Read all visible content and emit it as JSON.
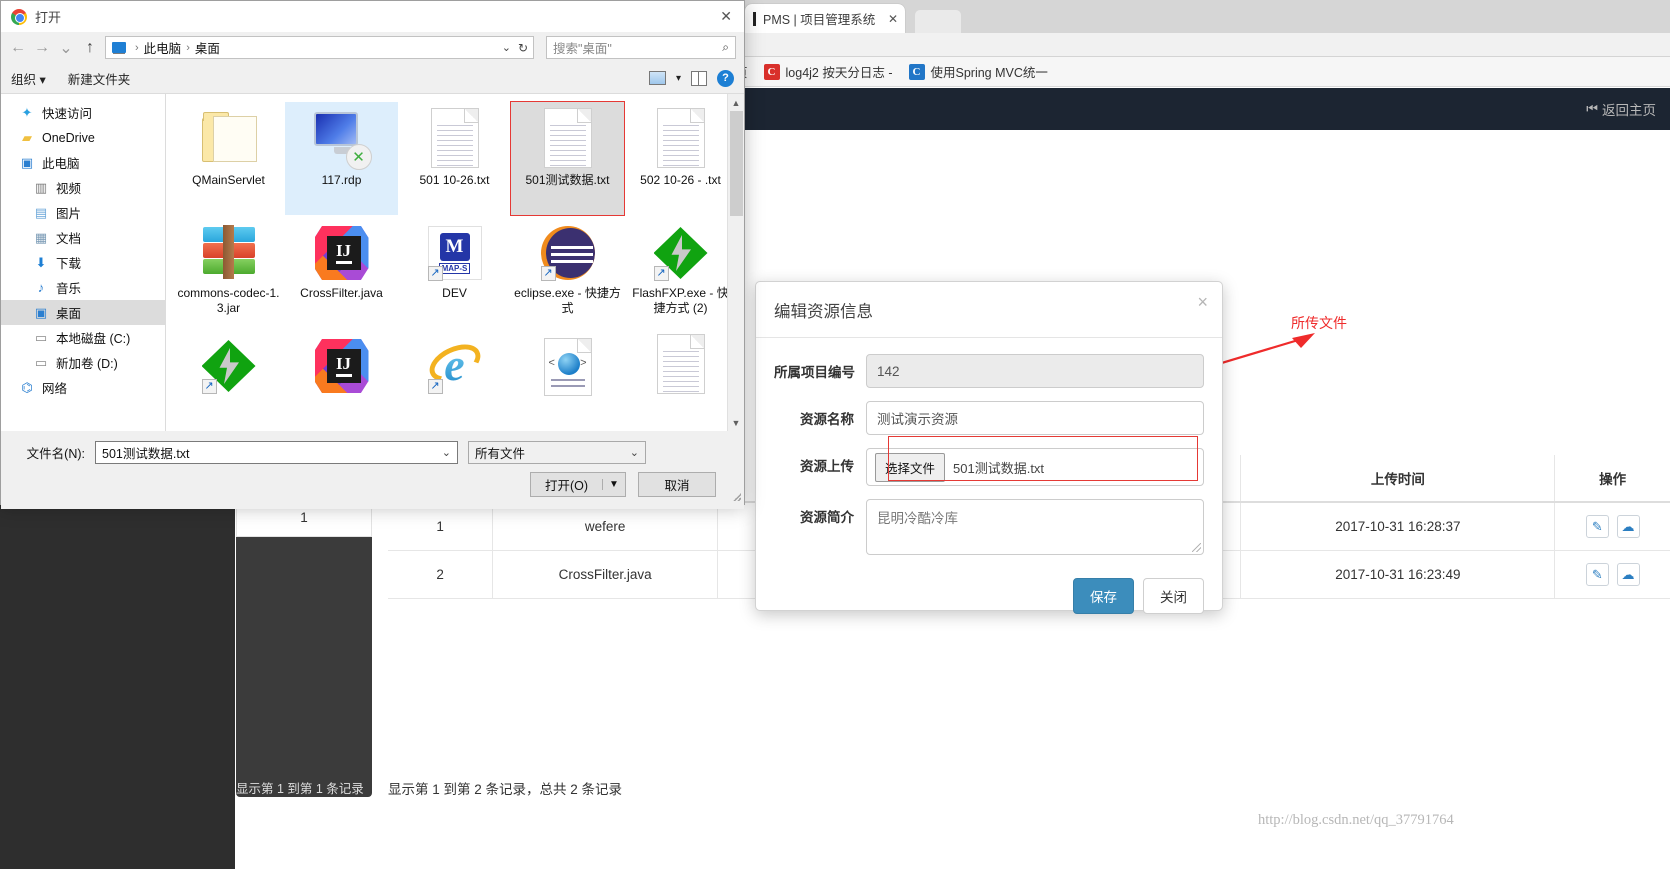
{
  "browser": {
    "tabs": [
      {
        "title": "PMS | 项目管理系统",
        "close": "✕"
      }
    ],
    "left_close": "✕",
    "bookmarks": [
      {
        "icon_letter": "页",
        "label": "页",
        "icon_kind": "plain"
      },
      {
        "icon_letter": "C",
        "label": "log4j2 按天分日志 -",
        "icon_kind": "red"
      },
      {
        "icon_letter": "C",
        "label": "使用Spring MVC统一",
        "icon_kind": "blue"
      }
    ]
  },
  "site": {
    "back_home": "返回主页",
    "back_home_icon": "⏮"
  },
  "table": {
    "headers": [
      "",
      "",
      "",
      "上传时间",
      "操作"
    ],
    "header_time": "上传时间",
    "header_op": "操作",
    "rows": [
      {
        "id": "1",
        "name": "wefere",
        "desc": "",
        "time": "2017-10-31 16:28:37",
        "edit_icon": "✎",
        "download_icon": "☁"
      },
      {
        "id": "2",
        "name": "CrossFilter.java",
        "desc": "",
        "time": "2017-10-31 16:23:49",
        "edit_icon": "✎",
        "download_icon": "☁"
      }
    ],
    "footer": "显示第 1 到第 2 条记录，总共 2 条记录"
  },
  "sidebar_table": {
    "value": "1",
    "footer": "显示第 1 到第 1 条记录"
  },
  "modal": {
    "title": "编辑资源信息",
    "close": "×",
    "fields": {
      "project_no_label": "所属项目编号",
      "project_no_value": "142",
      "res_name_label": "资源名称",
      "res_name_value": "测试演示资源",
      "upload_label": "资源上传",
      "upload_button": "选择文件",
      "upload_filename": "501测试数据.txt",
      "desc_label": "资源简介",
      "desc_value": "昆明冷酷冷库"
    },
    "save": "保存",
    "close_btn": "关闭"
  },
  "annotation": {
    "text": "所传文件"
  },
  "watermark": "http://blog.csdn.net/qq_37791764",
  "file_dialog": {
    "title": "打开",
    "close": "✕",
    "nav": {
      "back": "←",
      "forward": "→",
      "recent": "⌄",
      "up": "↑",
      "breadcrumb": [
        "此电脑",
        "桌面"
      ],
      "caret": "⌄",
      "refresh": "↻",
      "search_placeholder": "搜索\"桌面\""
    },
    "toolbar": {
      "organize": "组织 ▾",
      "new_folder": "新建文件夹",
      "view_caret": "▾",
      "help": "?"
    },
    "places": [
      {
        "label": "快速访问",
        "icon": "★",
        "indent": false,
        "selected": false
      },
      {
        "label": "OneDrive",
        "icon": "☁",
        "indent": false,
        "selected": false
      },
      {
        "label": "此电脑",
        "icon": "🖥",
        "indent": false,
        "selected": false
      },
      {
        "label": "视频",
        "icon": "🎞",
        "indent": true,
        "selected": false
      },
      {
        "label": "图片",
        "icon": "🖼",
        "indent": true,
        "selected": false
      },
      {
        "label": "文档",
        "icon": "📄",
        "indent": true,
        "selected": false
      },
      {
        "label": "下载",
        "icon": "⬇",
        "indent": true,
        "selected": false
      },
      {
        "label": "音乐",
        "icon": "♪",
        "indent": true,
        "selected": false
      },
      {
        "label": "桌面",
        "icon": "🖥",
        "indent": true,
        "selected": true
      },
      {
        "label": "本地磁盘 (C:)",
        "icon": "▤",
        "indent": true,
        "selected": false
      },
      {
        "label": "新加卷 (D:)",
        "icon": "▤",
        "indent": true,
        "selected": false
      },
      {
        "label": "网络",
        "icon": "🖧",
        "indent": false,
        "selected": false
      }
    ],
    "files": [
      {
        "label": "QMainServlet",
        "kind": "folder",
        "state": "none",
        "shortcut": false
      },
      {
        "label": "117.rdp",
        "kind": "rdp",
        "state": "hover",
        "shortcut": false
      },
      {
        "label": "501  10-26.txt",
        "kind": "doc",
        "state": "none",
        "shortcut": false
      },
      {
        "label": "501测试数据.txt",
        "kind": "doc",
        "state": "selected",
        "shortcut": false
      },
      {
        "label": "502  10-26 - .txt",
        "kind": "doc",
        "state": "none",
        "shortcut": false
      },
      {
        "label": "commons-codec-1.3.jar",
        "kind": "rar",
        "state": "none",
        "shortcut": false
      },
      {
        "label": "CrossFilter.java",
        "kind": "ij",
        "state": "none",
        "shortcut": false
      },
      {
        "label": "DEV",
        "kind": "dev",
        "state": "none",
        "shortcut": true
      },
      {
        "label": "eclipse.exe - 快捷方式",
        "kind": "eclipse",
        "state": "none",
        "shortcut": true
      },
      {
        "label": "FlashFXP.exe - 快捷方式 (2)",
        "kind": "flash",
        "state": "none",
        "shortcut": true
      },
      {
        "label": "",
        "kind": "flash",
        "state": "none",
        "shortcut": true
      },
      {
        "label": "",
        "kind": "ij",
        "state": "none",
        "shortcut": false
      },
      {
        "label": "",
        "kind": "ie",
        "state": "none",
        "shortcut": true
      },
      {
        "label": "",
        "kind": "html",
        "state": "none",
        "shortcut": false
      },
      {
        "label": "",
        "kind": "doc",
        "state": "none",
        "shortcut": false
      }
    ],
    "footer": {
      "filename_label": "文件名(N):",
      "filename_value": "501测试数据.txt",
      "filetype_value": "所有文件",
      "open_button": "打开(O)",
      "open_caret": "▼",
      "cancel_button": "取消"
    }
  }
}
